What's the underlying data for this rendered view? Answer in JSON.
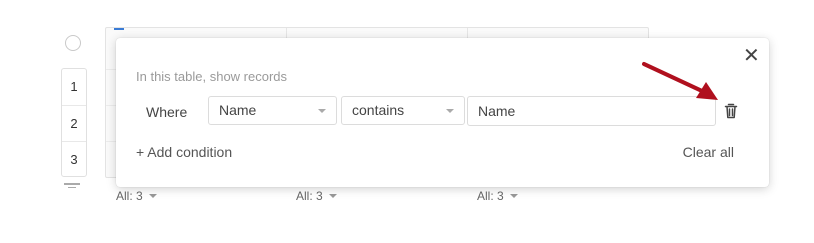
{
  "table": {
    "row_numbers": [
      "1",
      "2",
      "3"
    ],
    "column_summaries": [
      {
        "label": "All: 3"
      },
      {
        "label": "All: 3"
      },
      {
        "label": "All: 3"
      }
    ]
  },
  "filter_popup": {
    "intro_text": "In this table, show records",
    "where_label": "Where",
    "field_select": "Name",
    "operator_select": "contains",
    "value_input": "Name",
    "add_condition_label": "+ Add condition",
    "clear_all_label": "Clear all",
    "close_icon": "close-icon",
    "delete_icon": "trash-icon"
  },
  "annotation": {
    "arrow_color": "#b0101e"
  },
  "colors": {
    "accent": "#3a7bd5"
  }
}
